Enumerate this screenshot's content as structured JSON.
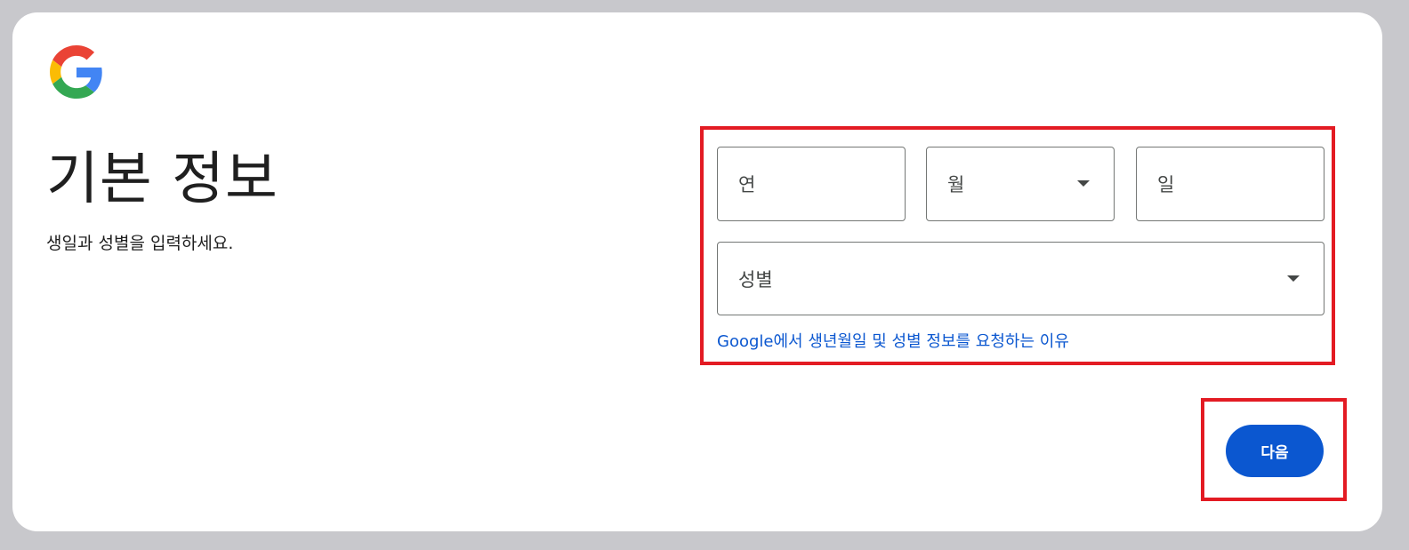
{
  "logo": {
    "icon": "google-g-icon",
    "colors": [
      "#4285F4",
      "#EA4335",
      "#FBBC05",
      "#34A853"
    ]
  },
  "header": {
    "title": "기본 정보",
    "subtitle": "생일과 성별을 입력하세요."
  },
  "form": {
    "year_placeholder": "연",
    "month_placeholder": "월",
    "day_placeholder": "일",
    "gender_placeholder": "성별",
    "why_link": "Google에서 생년월일 및 성별 정보를 요청하는 이유"
  },
  "actions": {
    "next_label": "다음"
  },
  "colors": {
    "primary": "#0b57d0",
    "highlight": "#e31b23",
    "field_border": "#747775",
    "background": "#c8c8cc"
  }
}
